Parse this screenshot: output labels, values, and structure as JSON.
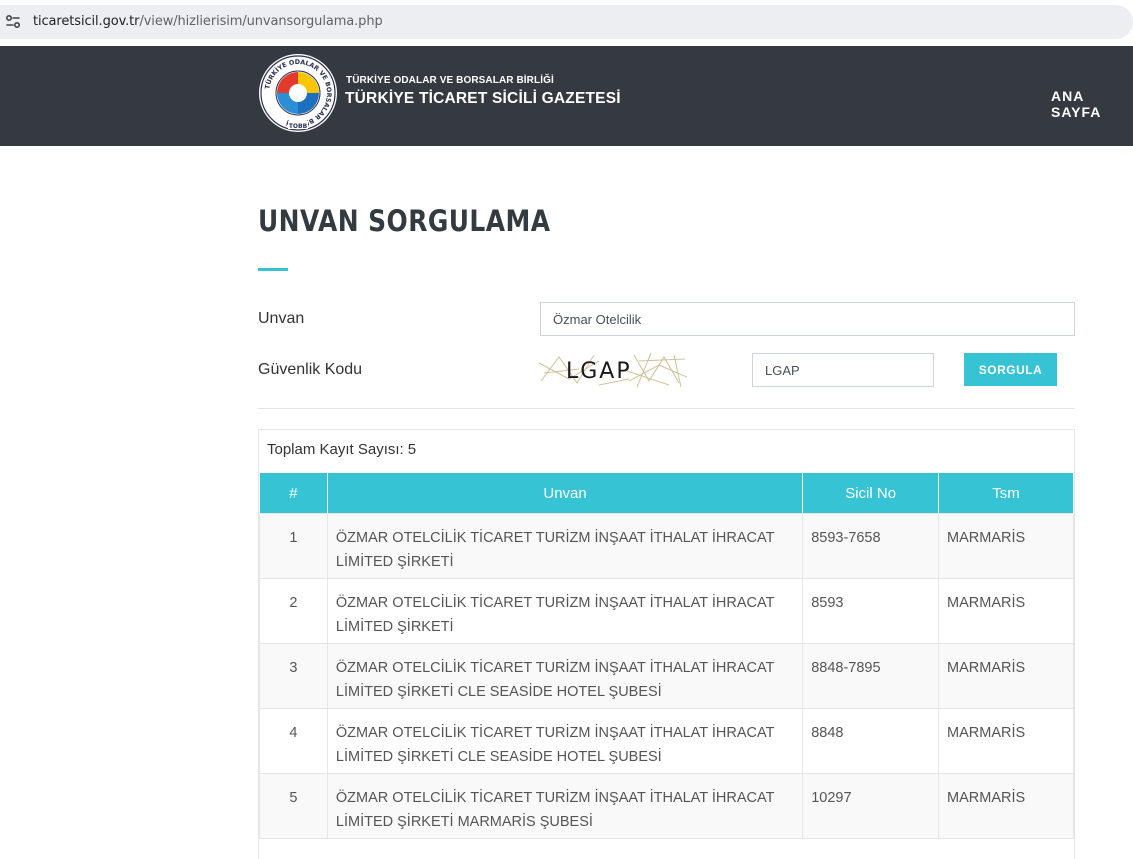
{
  "browser": {
    "url_domain": "ticaretsicil.gov.tr",
    "url_path": "/view/hizlierisim/unvansorgulama.php"
  },
  "header": {
    "org_small": "TÜRKİYE ODALAR VE BORSALAR BİRLİĞİ",
    "org_large": "TÜRKİYE TİCARET SİCİLİ GAZETESİ",
    "logo_text": "TÜRKİYE ODALAR VE BORSALAR BİRLİĞİ",
    "logo_abbr": "TOBB",
    "nav_home": "ANA SAYFA"
  },
  "page": {
    "title": "UNVAN SORGULAMA"
  },
  "form": {
    "unvan_label": "Unvan",
    "unvan_value": "Özmar Otelcilik",
    "kod_label": "Güvenlik Kodu",
    "captcha_text": "LGAP",
    "kod_value": "LGAP",
    "submit_label": "SORGULA"
  },
  "results": {
    "total_label": "Toplam Kayıt Sayısı:",
    "total_count": "5",
    "columns": [
      "#",
      "Unvan",
      "Sicil No",
      "Tsm"
    ],
    "rows": [
      {
        "no": "1",
        "unvan_l1": "ÖZMAR OTELCİLİK TİCARET TURİZM İNŞAAT İTHALAT İHRACAT",
        "unvan_l2": "LİMİTED ŞİRKETİ",
        "sicil": "8593-7658",
        "tsm": "MARMARİS"
      },
      {
        "no": "2",
        "unvan_l1": "ÖZMAR OTELCİLİK TİCARET TURİZM İNŞAAT İTHALAT İHRACAT",
        "unvan_l2": "LİMİTED ŞİRKETİ",
        "sicil": "8593",
        "tsm": "MARMARİS"
      },
      {
        "no": "3",
        "unvan_l1": "ÖZMAR OTELCİLİK TİCARET TURİZM İNŞAAT İTHALAT İHRACAT",
        "unvan_l2": "LİMİTED ŞİRKETİ CLE SEASİDE HOTEL ŞUBESİ",
        "sicil": "8848-7895",
        "tsm": "MARMARİS"
      },
      {
        "no": "4",
        "unvan_l1": "ÖZMAR OTELCİLİK TİCARET TURİZM İNŞAAT İTHALAT İHRACAT",
        "unvan_l2": "LİMİTED ŞİRKETİ CLE SEASİDE HOTEL ŞUBESİ",
        "sicil": "8848",
        "tsm": "MARMARİS"
      },
      {
        "no": "5",
        "unvan_l1": "ÖZMAR OTELCİLİK TİCARET TURİZM İNŞAAT İTHALAT İHRACAT",
        "unvan_l2": "LİMİTED ŞİRKETİ MARMARİS ŞUBESİ",
        "sicil": "10297",
        "tsm": "MARMARİS"
      }
    ]
  },
  "colors": {
    "header_bg": "#343a40",
    "accent": "#36c3d3"
  }
}
